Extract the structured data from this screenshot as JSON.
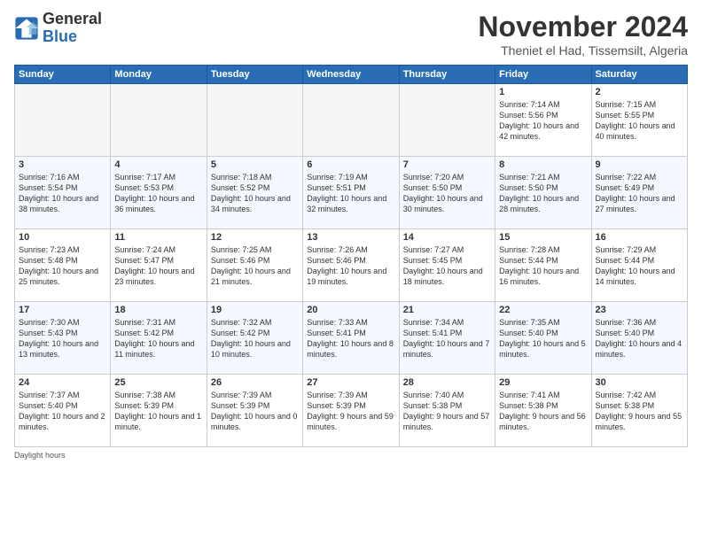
{
  "logo": {
    "general": "General",
    "blue": "Blue"
  },
  "header": {
    "month": "November 2024",
    "location": "Theniet el Had, Tissemsilt, Algeria"
  },
  "days_of_week": [
    "Sunday",
    "Monday",
    "Tuesday",
    "Wednesday",
    "Thursday",
    "Friday",
    "Saturday"
  ],
  "weeks": [
    {
      "days": [
        {
          "num": "",
          "empty": true
        },
        {
          "num": "",
          "empty": true
        },
        {
          "num": "",
          "empty": true
        },
        {
          "num": "",
          "empty": true
        },
        {
          "num": "",
          "empty": true
        },
        {
          "num": "1",
          "sunrise": "7:14 AM",
          "sunset": "5:56 PM",
          "daylight": "10 hours and 42 minutes."
        },
        {
          "num": "2",
          "sunrise": "7:15 AM",
          "sunset": "5:55 PM",
          "daylight": "10 hours and 40 minutes."
        }
      ]
    },
    {
      "days": [
        {
          "num": "3",
          "sunrise": "7:16 AM",
          "sunset": "5:54 PM",
          "daylight": "10 hours and 38 minutes."
        },
        {
          "num": "4",
          "sunrise": "7:17 AM",
          "sunset": "5:53 PM",
          "daylight": "10 hours and 36 minutes."
        },
        {
          "num": "5",
          "sunrise": "7:18 AM",
          "sunset": "5:52 PM",
          "daylight": "10 hours and 34 minutes."
        },
        {
          "num": "6",
          "sunrise": "7:19 AM",
          "sunset": "5:51 PM",
          "daylight": "10 hours and 32 minutes."
        },
        {
          "num": "7",
          "sunrise": "7:20 AM",
          "sunset": "5:50 PM",
          "daylight": "10 hours and 30 minutes."
        },
        {
          "num": "8",
          "sunrise": "7:21 AM",
          "sunset": "5:50 PM",
          "daylight": "10 hours and 28 minutes."
        },
        {
          "num": "9",
          "sunrise": "7:22 AM",
          "sunset": "5:49 PM",
          "daylight": "10 hours and 27 minutes."
        }
      ]
    },
    {
      "days": [
        {
          "num": "10",
          "sunrise": "7:23 AM",
          "sunset": "5:48 PM",
          "daylight": "10 hours and 25 minutes."
        },
        {
          "num": "11",
          "sunrise": "7:24 AM",
          "sunset": "5:47 PM",
          "daylight": "10 hours and 23 minutes."
        },
        {
          "num": "12",
          "sunrise": "7:25 AM",
          "sunset": "5:46 PM",
          "daylight": "10 hours and 21 minutes."
        },
        {
          "num": "13",
          "sunrise": "7:26 AM",
          "sunset": "5:46 PM",
          "daylight": "10 hours and 19 minutes."
        },
        {
          "num": "14",
          "sunrise": "7:27 AM",
          "sunset": "5:45 PM",
          "daylight": "10 hours and 18 minutes."
        },
        {
          "num": "15",
          "sunrise": "7:28 AM",
          "sunset": "5:44 PM",
          "daylight": "10 hours and 16 minutes."
        },
        {
          "num": "16",
          "sunrise": "7:29 AM",
          "sunset": "5:44 PM",
          "daylight": "10 hours and 14 minutes."
        }
      ]
    },
    {
      "days": [
        {
          "num": "17",
          "sunrise": "7:30 AM",
          "sunset": "5:43 PM",
          "daylight": "10 hours and 13 minutes."
        },
        {
          "num": "18",
          "sunrise": "7:31 AM",
          "sunset": "5:42 PM",
          "daylight": "10 hours and 11 minutes."
        },
        {
          "num": "19",
          "sunrise": "7:32 AM",
          "sunset": "5:42 PM",
          "daylight": "10 hours and 10 minutes."
        },
        {
          "num": "20",
          "sunrise": "7:33 AM",
          "sunset": "5:41 PM",
          "daylight": "10 hours and 8 minutes."
        },
        {
          "num": "21",
          "sunrise": "7:34 AM",
          "sunset": "5:41 PM",
          "daylight": "10 hours and 7 minutes."
        },
        {
          "num": "22",
          "sunrise": "7:35 AM",
          "sunset": "5:40 PM",
          "daylight": "10 hours and 5 minutes."
        },
        {
          "num": "23",
          "sunrise": "7:36 AM",
          "sunset": "5:40 PM",
          "daylight": "10 hours and 4 minutes."
        }
      ]
    },
    {
      "days": [
        {
          "num": "24",
          "sunrise": "7:37 AM",
          "sunset": "5:40 PM",
          "daylight": "10 hours and 2 minutes."
        },
        {
          "num": "25",
          "sunrise": "7:38 AM",
          "sunset": "5:39 PM",
          "daylight": "10 hours and 1 minute."
        },
        {
          "num": "26",
          "sunrise": "7:39 AM",
          "sunset": "5:39 PM",
          "daylight": "10 hours and 0 minutes."
        },
        {
          "num": "27",
          "sunrise": "7:39 AM",
          "sunset": "5:39 PM",
          "daylight": "9 hours and 59 minutes."
        },
        {
          "num": "28",
          "sunrise": "7:40 AM",
          "sunset": "5:38 PM",
          "daylight": "9 hours and 57 minutes."
        },
        {
          "num": "29",
          "sunrise": "7:41 AM",
          "sunset": "5:38 PM",
          "daylight": "9 hours and 56 minutes."
        },
        {
          "num": "30",
          "sunrise": "7:42 AM",
          "sunset": "5:38 PM",
          "daylight": "9 hours and 55 minutes."
        }
      ]
    }
  ],
  "footer": {
    "daylight_label": "Daylight hours"
  }
}
